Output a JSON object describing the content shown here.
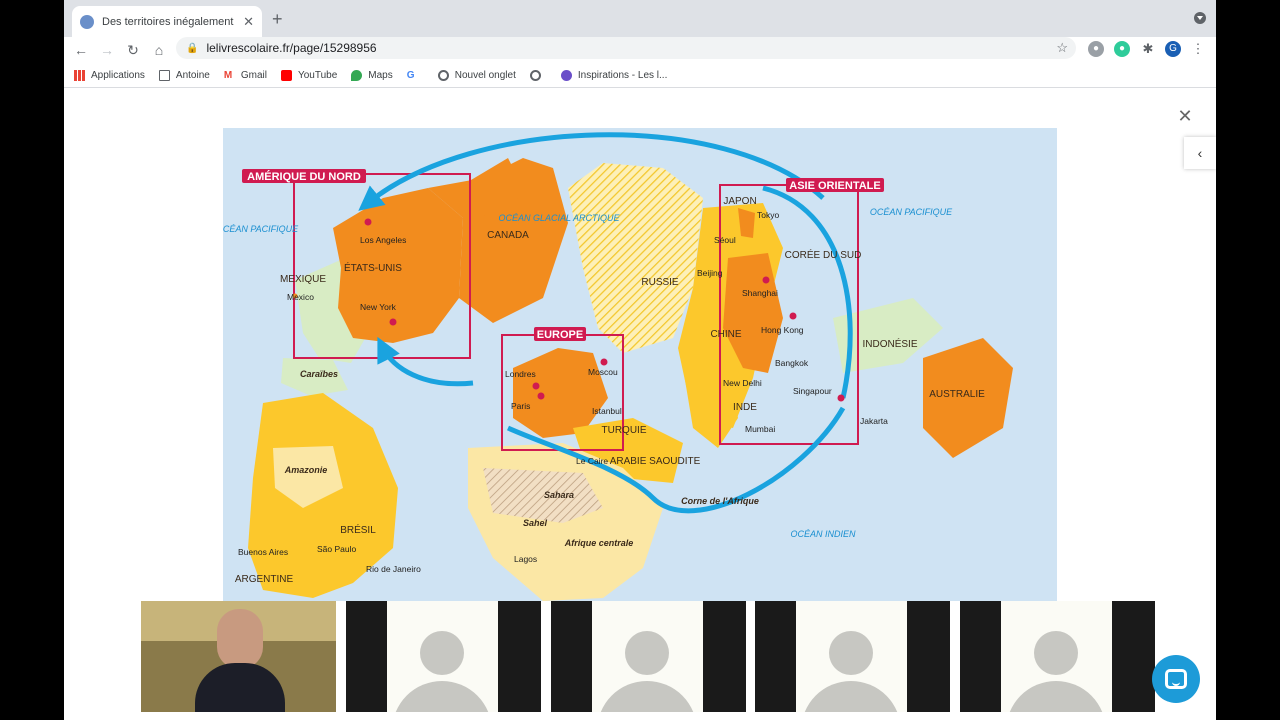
{
  "browser": {
    "tab_title": "Des territoires inégalement intégrés",
    "url": "lelivrescolaire.fr/page/15298956",
    "profile_initial": "G"
  },
  "bookmarks": [
    "Applications",
    "Antoine",
    "Gmail",
    "YouTube",
    "Maps",
    "Nouvel onglet",
    "Inspirations - Les l..."
  ],
  "map": {
    "boxes": {
      "north_america": "AMÉRIQUE DU NORD",
      "east_asia": "ASIE ORIENTALE",
      "europe": "EUROPE"
    },
    "oceans": {
      "pacific_west": "OCÉAN PACIFIQUE",
      "arctic": "OCÉAN GLACIAL ARCTIQUE",
      "pacific_east": "OCÉAN PACIFIQUE",
      "indian": "OCÉAN INDIEN"
    },
    "countries": {
      "canada": "CANADA",
      "usa": "ÉTATS-UNIS",
      "mexico": "MEXIQUE",
      "russia": "RUSSIE",
      "japan": "JAPON",
      "korea": "CORÉE DU SUD",
      "china": "CHINE",
      "india": "INDE",
      "indonesia": "INDONÉSIE",
      "australia": "AUSTRALIE",
      "turkey": "TURQUIE",
      "saudi": "ARABIE SAOUDITE",
      "brazil": "BRÉSIL",
      "argentina": "ARGENTINE"
    },
    "cities": {
      "los_angeles": "Los Angeles",
      "new_york": "New York",
      "mexico": "Mexico",
      "tokyo": "Tokyo",
      "seoul": "Séoul",
      "beijing": "Beijing",
      "shanghai": "Shanghai",
      "hong_kong": "Hong Kong",
      "bangkok": "Bangkok",
      "singapore": "Singapour",
      "jakarta": "Jakarta",
      "new_delhi": "New Delhi",
      "mumbai": "Mumbai",
      "london": "Londres",
      "paris": "Paris",
      "moscow": "Moscou",
      "istanbul": "Istanbul",
      "cairo": "Le Caire",
      "lagos": "Lagos",
      "sao_paulo": "São Paulo",
      "rio": "Rio de Janeiro",
      "buenos_aires": "Buenos Aires"
    },
    "regions": {
      "caribbean": "Caraïbes",
      "amazon": "Amazonie",
      "sahara": "Sahara",
      "sahel": "Sahel",
      "central_africa": "Afrique centrale",
      "horn_africa": "Corne de l'Afrique"
    }
  },
  "colors": {
    "ocean": "#cfe3f3",
    "core": "#f28c1e",
    "semi_core": "#fcc82c",
    "periphery": "#fbe7a5",
    "margin": "#d8ecc4",
    "box": "#d01b50",
    "flow": "#1aa3df"
  }
}
